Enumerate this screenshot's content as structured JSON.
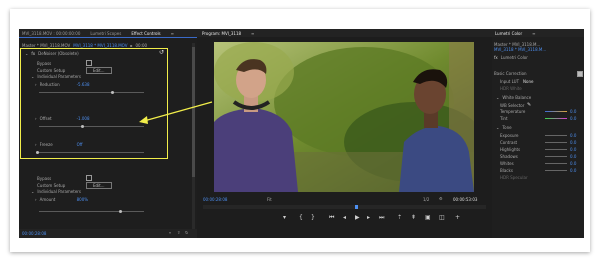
{
  "effect_controls": {
    "tabs": [
      "MVI_3118.MOV : 00:00:00:00",
      "Lumetri Scopes",
      "Effect Controls"
    ],
    "clip_path": "Master * MVI_3118.MOV",
    "clip_link": "MVI_3118 * MVI_3118.MOV",
    "timecode_top": "00:00",
    "effect_name": "DeNoiser (Obsolete)",
    "bypass_label": "Bypass",
    "custom_setup_label": "Custom Setup",
    "edit_button": "Edit...",
    "individual_params_label": "Individual Parameters",
    "reduction_label": "Reduction",
    "reduction_value": "-5.638",
    "offset_label": "Offset",
    "offset_value": "-1.008",
    "freeze_label": "Freeze",
    "freeze_value": "Off",
    "bypass2_label": "Bypass",
    "custom_setup2_label": "Custom Setup",
    "edit_button2": "Edit...",
    "individual_params2_label": "Individual Parameters",
    "amount_label": "Amount",
    "amount_value": "800%",
    "footer_timecode": "00:00:28:08"
  },
  "program": {
    "title": "Program: MVI_3118",
    "timecode_left": "00:00:28:08",
    "fit_label": "Fit",
    "quality_label": "1/2",
    "timecode_right": "00:00:53:03"
  },
  "lumetri": {
    "tabs": [
      "Lumetri Color"
    ],
    "clip_path": "Master * MVI_3118.M...",
    "clip_link": "MVI_3118 * MVI_3118.M...",
    "panel_title": "Lumetri Color",
    "basic_correction_label": "Basic Correction",
    "input_lut_label": "Input LUT",
    "input_lut_value": "None",
    "hdr_white_label": "HDR White",
    "white_balance_label": "White Balance",
    "wb_selector_label": "WB Selector",
    "temperature_label": "Temperature",
    "temperature_value": "0.0",
    "tint_label": "Tint",
    "tint_value": "0.0",
    "tone_label": "Tone",
    "exposure_label": "Exposure",
    "exposure_value": "0.0",
    "contrast_label": "Contrast",
    "contrast_value": "0.0",
    "highlights_label": "Highlights",
    "highlights_value": "0.0",
    "shadows_label": "Shadows",
    "shadows_value": "0.0",
    "whites_label": "Whites",
    "whites_value": "0.0",
    "blacks_label": "Blacks",
    "blacks_value": "0.0",
    "hdr_specular_label": "HDR Specular"
  },
  "colors": {
    "highlight": "#f2ee4a",
    "accent": "#4d8ff0",
    "panel": "#1d1d1d"
  }
}
